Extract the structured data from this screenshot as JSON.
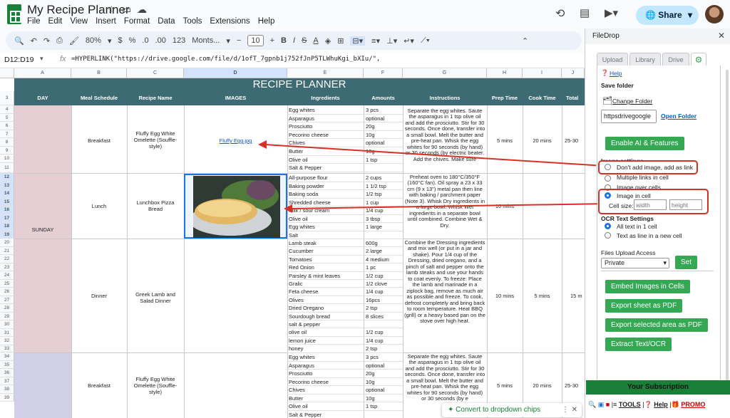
{
  "doc": {
    "title": "My Recipe Planner",
    "menu": [
      "File",
      "Edit",
      "View",
      "Insert",
      "Format",
      "Data",
      "Tools",
      "Extensions",
      "Help"
    ],
    "share_label": "Share"
  },
  "toolbar": {
    "zoom": "80%",
    "currency": "$",
    "percent": "%",
    "dec_less": ".0",
    "dec_more": ".00",
    "numfmt": "123",
    "font": "Monts...",
    "font_size": "10",
    "bold": "B",
    "italic": "I",
    "strike": "S",
    "textcolor": "A"
  },
  "formula": {
    "name_box": "D12:D19",
    "fx": "fx",
    "content": "=HYPERLINK(\"https://drive.google.com/file/d/1ofT_7gpnb1j752fJnP5TLWhuKgi_bXIu/\","
  },
  "sheet": {
    "columns": [
      "A",
      "B",
      "C",
      "D",
      "E",
      "F",
      "G",
      "H",
      "I",
      "J"
    ],
    "title": "RECIPE PLANNER",
    "headers": [
      "DAY",
      "Meal Schedule",
      "Recipe Name",
      "IMAGES",
      "Ingredients",
      "Amounts",
      "Instructions",
      "Prep Time",
      "Cook Time",
      "Total"
    ],
    "rows": [
      "3",
      "4",
      "5",
      "6",
      "7",
      "8",
      "9",
      "10",
      "11",
      "12",
      "13",
      "14",
      "15",
      "16",
      "17",
      "18",
      "19",
      "20",
      "21",
      "22",
      "23",
      "24",
      "25",
      "26",
      "27",
      "28",
      "29",
      "30",
      "31",
      "32",
      "33",
      "34",
      "35",
      "36",
      "37",
      "38",
      "39"
    ],
    "day": "SUNDAY",
    "breakfast": {
      "meal": "Breakfast",
      "recipe": "Fluffy Egg White Omelette (Souffle-style)",
      "link": "Fluffy Egg.jpg",
      "prep": "5 mins",
      "cook": "20 mins",
      "total": "25-30",
      "ingredients": [
        [
          "Egg whites",
          "3 pcs"
        ],
        [
          "Asparagus",
          "optional"
        ],
        [
          "Prosciutto",
          "20g"
        ],
        [
          "Pecorino cheese",
          "10g"
        ],
        [
          "Chives",
          "optional"
        ],
        [
          "Butter",
          "10g"
        ],
        [
          "Olive oil",
          "1 tsp"
        ],
        [
          "Salt & Pepper",
          ""
        ]
      ],
      "instructions": "Separate the egg whites. Saute the asparagus in 1 tsp olive oil and add the prosciutto. Stir for 30 seconds. Once done, transfer into a small bowl. Melt the butter and pre-heat pan. Whisk the egg whites for 90 seconds (by hand) or 30 seconds (by electric beater. Add the chives. Make sure"
    },
    "lunch": {
      "meal": "Lunch",
      "recipe": "Lunchbox Pizza Bread",
      "prep": "10 mins",
      "cook": "",
      "ingredients": [
        [
          "All-purpose flour",
          "2 cups"
        ],
        [
          "Baking powder",
          "1 1/2 tsp"
        ],
        [
          "Baking soda",
          "1/2 tsp"
        ],
        [
          "Shredded cheese",
          "1 cup"
        ],
        [
          "Milk / sour cream",
          "1/4 cup"
        ],
        [
          "Olive oil",
          "3 tbsp"
        ],
        [
          "Egg whites",
          "1 large"
        ],
        [
          "Salt",
          ""
        ]
      ],
      "instructions": "Preheat oven to 180°C/350°F (160°C fan). Oil spray a 23 x 33 cm (9 x 13\") metal pan then line with baking / parchment paper (Note 3). Whisk Dry ingredients in a large bowl. Whisk Wet ingredients in a separate bowl until combined. Combine Wet & Dry."
    },
    "dinner": {
      "meal": "Dinner",
      "recipe": "Greek Lamb and Salad Dinner",
      "prep": "10 mins",
      "cook": "5 mins",
      "total": "15 m",
      "ingredients": [
        [
          "Lamb steak",
          "600g"
        ],
        [
          "Cucumber",
          "2 large"
        ],
        [
          "Tomatoes",
          "4 medium"
        ],
        [
          "Red Onion",
          "1 pc"
        ],
        [
          "Parsley & mint leaves",
          "1/2 cup"
        ],
        [
          "Gralic",
          "1/2 clove"
        ],
        [
          "Feta cheese",
          "1/4 cup"
        ],
        [
          "Olives",
          "16pcs"
        ],
        [
          "Dried Oregano",
          "2 tsp"
        ],
        [
          "Sourdough bread",
          "8 slices"
        ],
        [
          "salt & pepper",
          ""
        ],
        [
          "olive oil",
          "1/2 cup"
        ],
        [
          "lemon juice",
          "1/4 cup"
        ],
        [
          "honey",
          "2 tsp"
        ]
      ],
      "instructions": "Combine the Dressing ingredients and mix well (or put in a jar and shake). Pour 1/4 cup of the Dressing, dried oregano, and a pinch of salt and pepper onto the lamb steaks and use your hands to coat evenly. To freeze: Place the lamb and marinade in a ziplock bag, remove as much air as possible and freeze. To cook, defrost completely and bring back to room temperature. Heat BBQ (grill) or a heavy based pan on the stove over high heat."
    },
    "breakfast2": {
      "meal": "Breakfast",
      "recipe": "Fluffy Egg White Omelette (Souffle-style)",
      "prep": "5 mins",
      "cook": "20 mins",
      "total": "25-30",
      "ingredients": [
        [
          "Egg whites",
          "3 pcs"
        ],
        [
          "Asparagus",
          "optional"
        ],
        [
          "Prosciutto",
          "20g"
        ],
        [
          "Pecorino cheese",
          "10g"
        ],
        [
          "Chives",
          "optional"
        ],
        [
          "Butter",
          "10g"
        ],
        [
          "Olive oil",
          "1 tsp"
        ],
        [
          "Salt & Pepper",
          ""
        ]
      ],
      "instructions": "Separate the egg whites. Saute the asparagus in 1 tsp olive oil and add the prosciutto. Stir for 30 seconds. Once done, transfer into a small bowl. Melt the butter and pre-heat pan. Whisk the egg whites for 90 seconds (by hand) or 30 seconds (by e"
    }
  },
  "chip": "Convert to dropdown chips",
  "panel": {
    "title": "FileDrop",
    "tabs": [
      "Upload",
      "Library",
      "Drive"
    ],
    "help": "Help",
    "save_folder": "Save folder",
    "change_folder": "Change Folder",
    "folder_value": "httpsdrivegoogle",
    "open_folder": "Open Folder",
    "enable_ai": "Enable AI & Features",
    "image_settings": "Image settings",
    "opt_link": "Don't add image, add as link",
    "opt_multi": "Multiple links in cell",
    "opt_over": "Image over cells",
    "opt_in": "Image in cell",
    "cell_size": "Cell size:",
    "width_ph": "width",
    "height_ph": "height",
    "ocr_title": "OCR Text Settings",
    "ocr_all": "All text in 1 cell",
    "ocr_line": "Text as line in a new cell",
    "access_title": "Files Upload Access",
    "access_value": "Private",
    "set": "Set",
    "embed": "Embed Images in Cells",
    "export_pdf": "Export sheet as PDF",
    "export_sel": "Export selected area as PDF",
    "extract": "Extract Text/OCR",
    "subscription": "Your Subscription",
    "tools": "TOOLS",
    "help2": "Help",
    "promo": "PROMO"
  }
}
